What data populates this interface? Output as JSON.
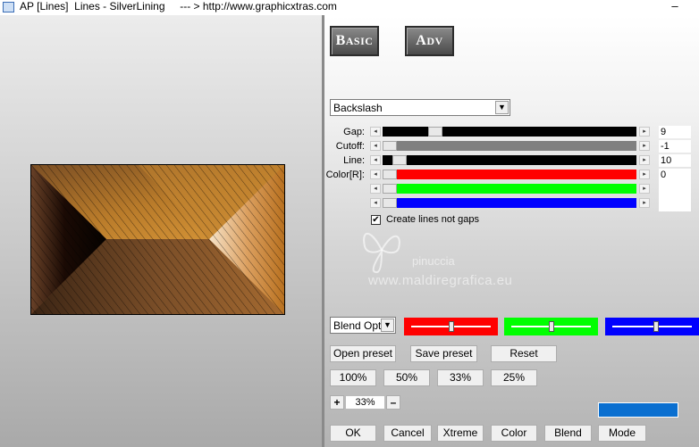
{
  "window": {
    "title": "AP [Lines]  Lines - SilverLining     --- > http://www.graphicxtras.com",
    "minimize_glyph": "–"
  },
  "modes": {
    "basic": "Basic",
    "adv": "Adv"
  },
  "style_select": {
    "value": "Backslash"
  },
  "params": [
    {
      "label": "Gap:",
      "value": "9",
      "fraction": 0.19,
      "track_color": "#000000"
    },
    {
      "label": "Cutoff:",
      "value": "-1",
      "fraction": 0.0,
      "track_color": "#808080"
    },
    {
      "label": "Line:",
      "value": "10",
      "fraction": 0.04,
      "track_color": "#000000"
    },
    {
      "label": "Color[R]:",
      "value": "0",
      "fraction": 0.0,
      "track_color": "#ff0000"
    },
    {
      "label": "",
      "value": "0",
      "fraction": 0.0,
      "track_color": "#00ff00"
    },
    {
      "label": "",
      "value": "0",
      "fraction": 0.0,
      "track_color": "#0000ff"
    }
  ],
  "create_lines": {
    "label": "Create lines not gaps",
    "checked": true,
    "glyph": "✔"
  },
  "watermark": {
    "name": "pinuccia",
    "site": "www.maldiregrafica.eu"
  },
  "blend": {
    "value": "Blend Opti"
  },
  "color_sliders": [
    {
      "color": "#ff0000",
      "fraction": 0.5
    },
    {
      "color": "#00ff00",
      "fraction": 0.5
    },
    {
      "color": "#0000ff",
      "fraction": 0.55
    }
  ],
  "buttons": {
    "open_preset": "Open preset",
    "save_preset": "Save preset",
    "reset": "Reset",
    "z100": "100%",
    "z50": "50%",
    "z33": "33%",
    "z25": "25%",
    "ok": "OK",
    "cancel": "Cancel",
    "xtreme": "Xtreme",
    "color": "Color",
    "blend": "Blend",
    "mode": "Mode"
  },
  "zoom": {
    "plus": "+",
    "value": "33%",
    "minus": "–"
  },
  "swatch": {
    "color": "#0a6fd0"
  }
}
